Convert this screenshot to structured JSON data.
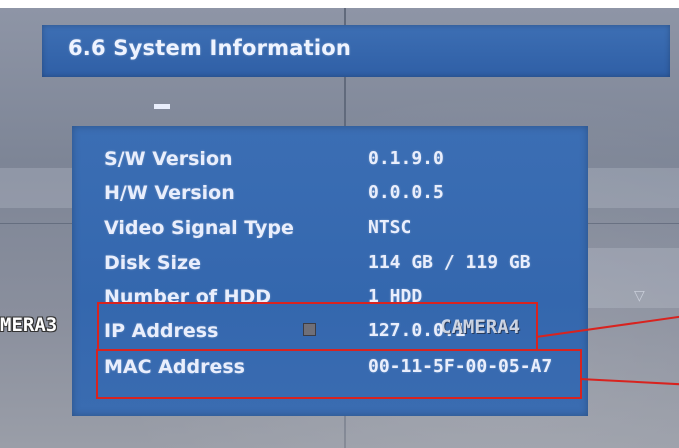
{
  "title": "6.6 System Information",
  "minus_symbol": "−",
  "info_rows": [
    {
      "label": "S/W Version",
      "value": "0.1.9.0"
    },
    {
      "label": "H/W Version",
      "value": "0.0.0.5"
    },
    {
      "label": "Video Signal Type",
      "value": "NTSC"
    },
    {
      "label": "Disk Size",
      "value": "114 GB / 119 GB"
    },
    {
      "label": "Number of HDD",
      "value": "1 HDD"
    },
    {
      "label": "IP Address",
      "value": "127.0.0.1"
    },
    {
      "label": "MAC Address",
      "value": "00-11-5F-00-05-A7"
    }
  ],
  "overlay": {
    "camera_left": "MERA3",
    "camera_right": "CAMERA4"
  },
  "colors": {
    "panel_blue": "#3467ae",
    "text": "#e9eefc",
    "highlight_red": "#d8231f"
  },
  "icons": [
    "square-icon",
    "chevron-down-icon"
  ]
}
